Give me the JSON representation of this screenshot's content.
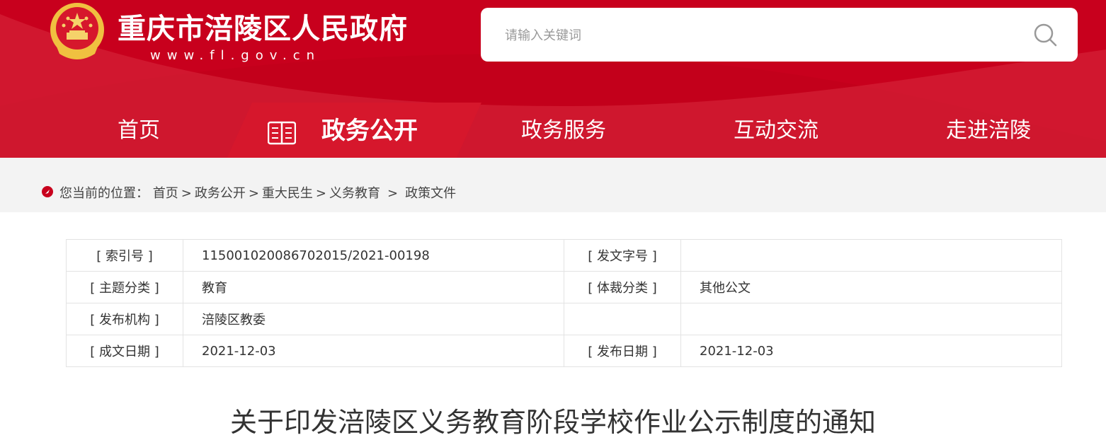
{
  "header": {
    "site_name": "重庆市涪陵区人民政府",
    "site_url": "www.fl.gov.cn",
    "search": {
      "placeholder": "请输入关键词",
      "value": ""
    }
  },
  "nav": {
    "items": [
      {
        "label": "首页",
        "active": false
      },
      {
        "label": "政务公开",
        "active": true
      },
      {
        "label": "政务服务",
        "active": false
      },
      {
        "label": "互动交流",
        "active": false
      },
      {
        "label": "走进涪陵",
        "active": false
      }
    ]
  },
  "breadcrumb": {
    "prefix": "您当前的位置：",
    "items": [
      "首页",
      "政务公开",
      "重大民生",
      "义务教育",
      "政策文件"
    ],
    "separator": ">"
  },
  "meta": {
    "rows": [
      [
        "[ 索引号 ]",
        "11500102008670201​5/2021-00198",
        "[ 发文字号 ]",
        ""
      ],
      [
        "[ 主题分类 ]",
        "教育",
        "[ 体裁分类 ]",
        "其他公文"
      ],
      [
        "[ 发布机构 ]",
        "涪陵区教委",
        "",
        ""
      ],
      [
        "[ 成文日期 ]",
        "2021-12-03",
        "[ 发布日期 ]",
        "2021-12-03"
      ]
    ]
  },
  "document": {
    "title": "关于印发涪陵区义务教育阶段学校作业公示制度的通知"
  },
  "colors": {
    "brand_red": "#c8001d",
    "active_tab_red": "#d6172c",
    "breadcrumb_bg": "#f3f3f3"
  }
}
